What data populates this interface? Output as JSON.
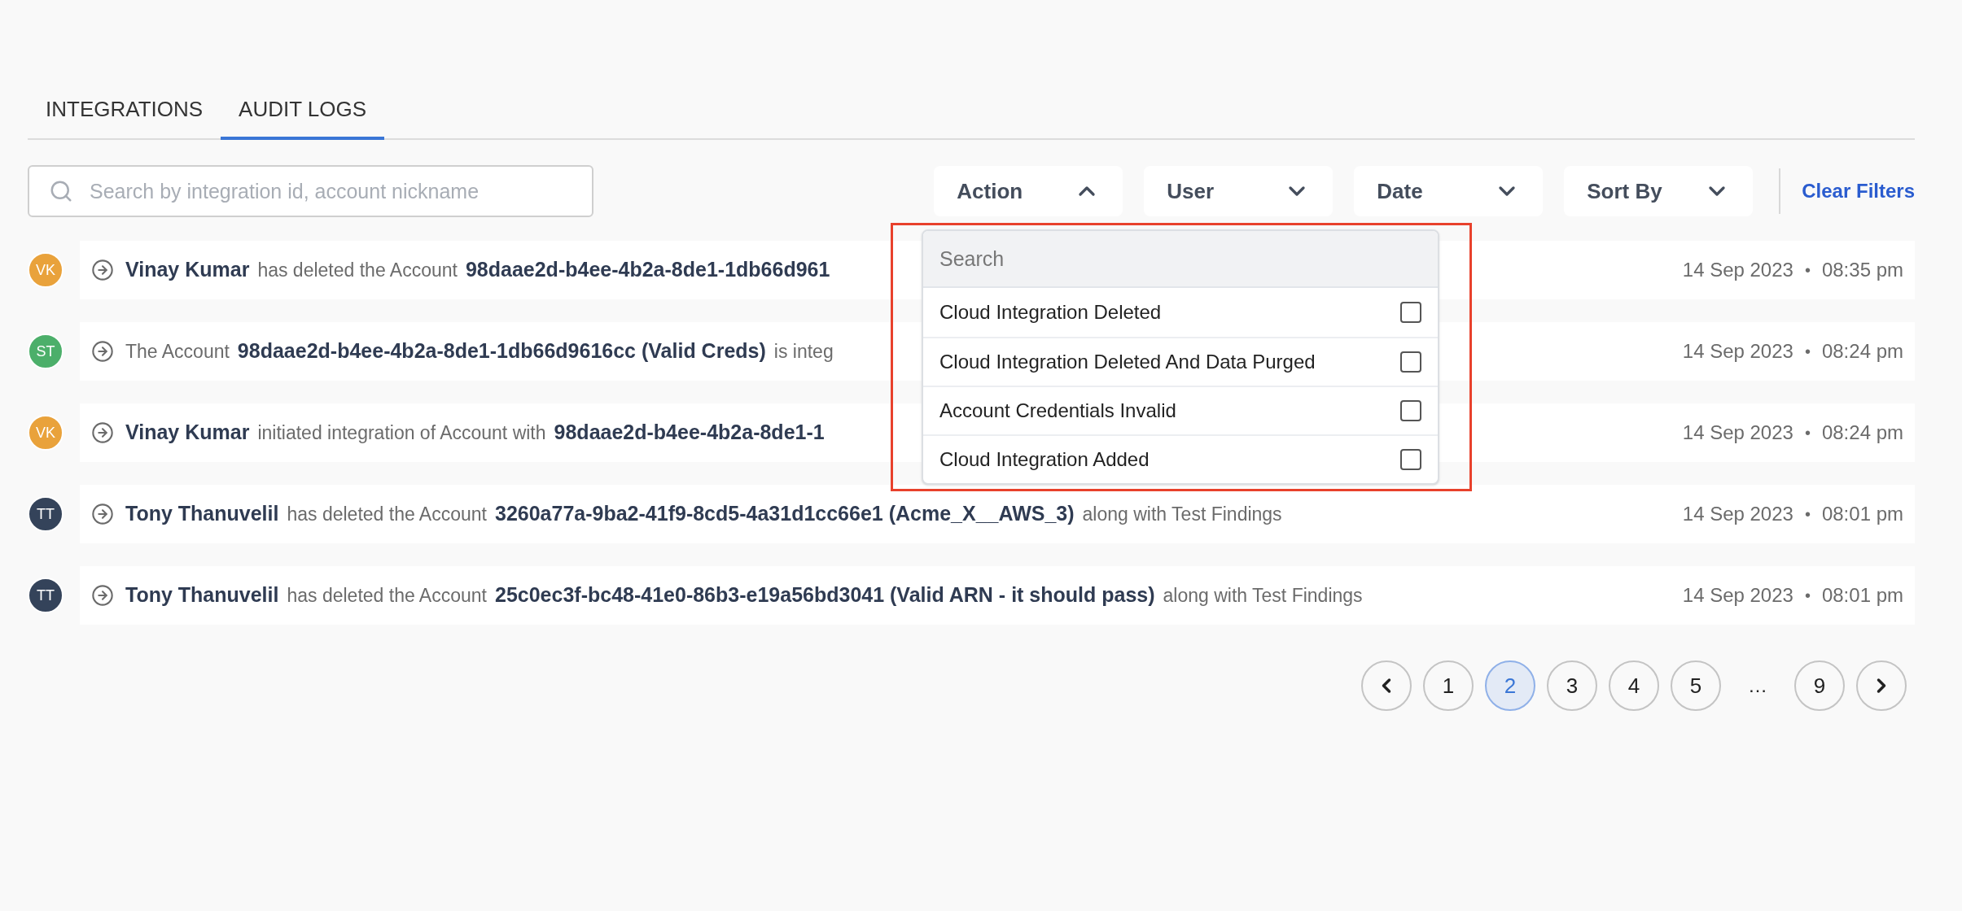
{
  "tabs": [
    {
      "label": "INTEGRATIONS",
      "selected": false
    },
    {
      "label": "AUDIT LOGS",
      "selected": true
    }
  ],
  "search": {
    "placeholder": "Search by integration id, account nickname"
  },
  "filters": [
    {
      "label": "Action",
      "expanded": true
    },
    {
      "label": "User",
      "expanded": false
    },
    {
      "label": "Date",
      "expanded": false
    },
    {
      "label": "Sort By",
      "expanded": false
    }
  ],
  "clear_filters": "Clear Filters",
  "action_menu": {
    "search_placeholder": "Search",
    "options": [
      {
        "label": "Cloud Integration Deleted",
        "checked": false
      },
      {
        "label": "Cloud Integration Deleted And Data Purged",
        "checked": false
      },
      {
        "label": "Account Credentials Invalid",
        "checked": false
      },
      {
        "label": "Cloud Integration Added",
        "checked": false
      }
    ]
  },
  "logs": [
    {
      "initials": "VK",
      "color": "#e9a23b",
      "segments": [
        {
          "kind": "user",
          "text": "Vinay Kumar"
        },
        {
          "kind": "text",
          "text": "has deleted the Account"
        },
        {
          "kind": "account",
          "text": "98daae2d-b4ee-4b2a-8de1-1db66d961"
        }
      ],
      "date": "14 Sep 2023",
      "separator": "•",
      "time": "08:35 pm"
    },
    {
      "initials": "ST",
      "color": "#4caf6a",
      "segments": [
        {
          "kind": "text",
          "text": "The Account"
        },
        {
          "kind": "account",
          "text": "98daae2d-b4ee-4b2a-8de1-1db66d9616cc (Valid Creds)"
        },
        {
          "kind": "text",
          "text": "is integ"
        }
      ],
      "date": "14 Sep 2023",
      "separator": "•",
      "time": "08:24 pm"
    },
    {
      "initials": "VK",
      "color": "#e9a23b",
      "segments": [
        {
          "kind": "user",
          "text": "Vinay Kumar"
        },
        {
          "kind": "text",
          "text": "initiated integration of Account with"
        },
        {
          "kind": "account",
          "text": "98daae2d-b4ee-4b2a-8de1-1"
        }
      ],
      "date": "14 Sep 2023",
      "separator": "•",
      "time": "08:24 pm"
    },
    {
      "initials": "TT",
      "color": "#34435a",
      "segments": [
        {
          "kind": "user",
          "text": "Tony Thanuvelil"
        },
        {
          "kind": "text",
          "text": "has deleted the Account"
        },
        {
          "kind": "account",
          "text": "3260a77a-9ba2-41f9-8cd5-4a31d1cc66e1 (Acme_X__AWS_3)"
        },
        {
          "kind": "text",
          "text": "along with Test Findings"
        }
      ],
      "date": "14 Sep 2023",
      "separator": "•",
      "time": "08:01 pm"
    },
    {
      "initials": "TT",
      "color": "#34435a",
      "segments": [
        {
          "kind": "user",
          "text": "Tony Thanuvelil"
        },
        {
          "kind": "text",
          "text": "has deleted the Account"
        },
        {
          "kind": "account",
          "text": "25c0ec3f-bc48-41e0-86b3-e19a56bd3041 (Valid ARN - it should pass)"
        },
        {
          "kind": "text",
          "text": "along with Test Findings"
        }
      ],
      "date": "14 Sep 2023",
      "separator": "•",
      "time": "08:01 pm"
    }
  ],
  "pagination": [
    {
      "kind": "page",
      "label": "1",
      "selected": false
    },
    {
      "kind": "page",
      "label": "2",
      "selected": true
    },
    {
      "kind": "page",
      "label": "3",
      "selected": false
    },
    {
      "kind": "page",
      "label": "4",
      "selected": false
    },
    {
      "kind": "page",
      "label": "5",
      "selected": false
    },
    {
      "kind": "ellipsis",
      "label": "…"
    },
    {
      "kind": "page",
      "label": "9",
      "selected": false
    }
  ]
}
